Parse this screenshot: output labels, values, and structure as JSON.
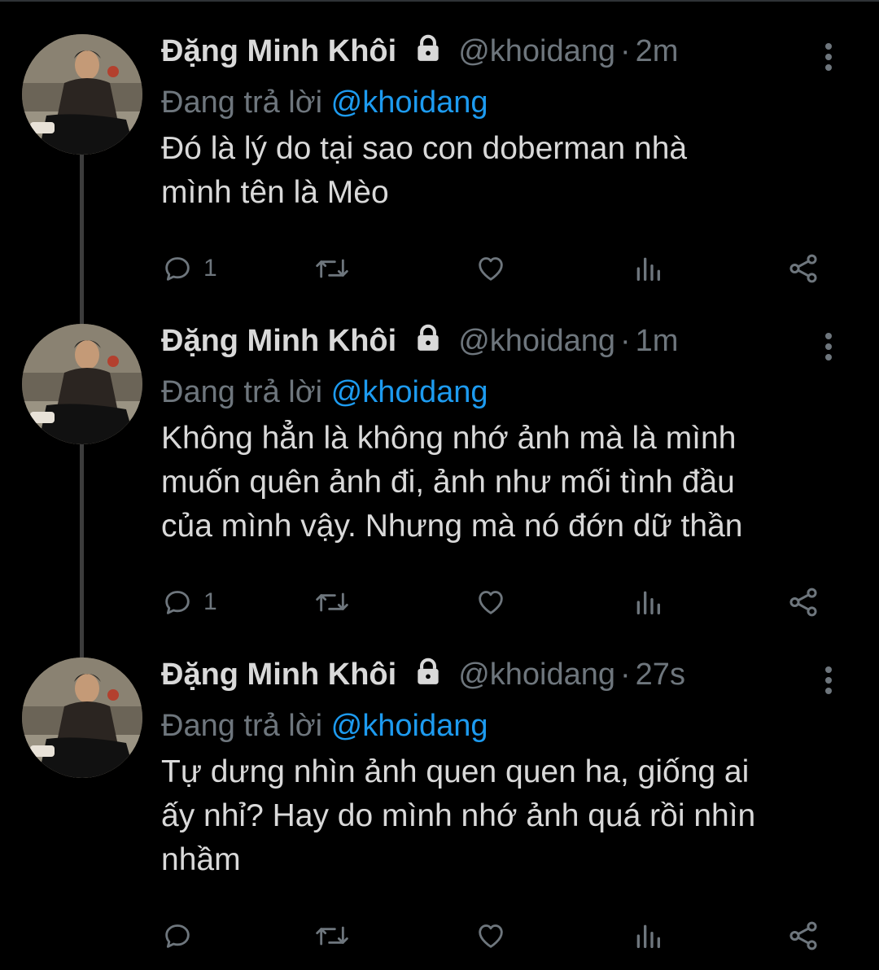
{
  "colors": {
    "background": "#000000",
    "name": "#d9d9d9",
    "secondary": "#6e767d",
    "mention": "#1d9bf0",
    "thread_line": "#3c3c3c"
  },
  "tweets": [
    {
      "name": "Đặng Minh Khôi",
      "handle": "@khoidang",
      "separator": "·",
      "time": "2m",
      "reply_prefix": "Đang trả lời ",
      "reply_to": "@khoidang",
      "text": "Đó là lý do tại sao con doberman nhà\nmình tên là Mèo",
      "reply_count": "1",
      "icons": [
        "lock-icon",
        "more-icon",
        "reply-icon",
        "retweet-icon",
        "like-icon",
        "analytics-icon",
        "share-icon"
      ]
    },
    {
      "name": "Đặng Minh Khôi",
      "handle": "@khoidang",
      "separator": "·",
      "time": "1m",
      "reply_prefix": "Đang trả lời ",
      "reply_to": "@khoidang",
      "text": "Không hẳn là không nhớ ảnh mà là mình\nmuốn quên ảnh đi, ảnh như mối tình đầu\ncủa mình vậy. Nhưng mà nó đớn dữ thần",
      "reply_count": "1",
      "icons": [
        "lock-icon",
        "more-icon",
        "reply-icon",
        "retweet-icon",
        "like-icon",
        "analytics-icon",
        "share-icon"
      ]
    },
    {
      "name": "Đặng Minh Khôi",
      "handle": "@khoidang",
      "separator": "·",
      "time": "27s",
      "reply_prefix": "Đang trả lời ",
      "reply_to": "@khoidang",
      "text": "Tự dưng nhìn ảnh quen quen ha, giống ai\nấy nhỉ? Hay do mình nhớ ảnh quá rồi nhìn\nnhầm",
      "reply_count": "",
      "icons": [
        "lock-icon",
        "more-icon",
        "reply-icon",
        "retweet-icon",
        "like-icon",
        "analytics-icon",
        "share-icon"
      ]
    }
  ]
}
